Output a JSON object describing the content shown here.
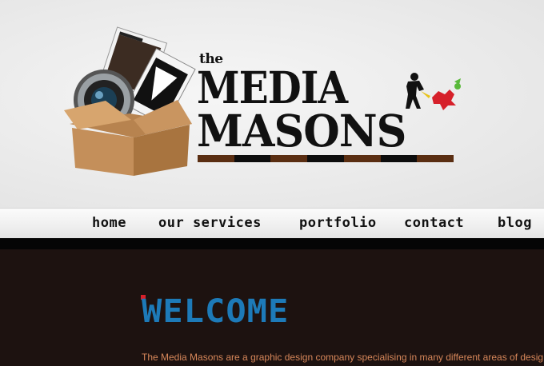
{
  "logo": {
    "the": "the",
    "line1": "MEDIA",
    "line2": "MASONS",
    "bar_colors": [
      "#5a2e12",
      "#0d0d0d",
      "#5a2e12",
      "#0d0d0d",
      "#5a2e12",
      "#0d0d0d",
      "#5a2e12"
    ]
  },
  "nav": {
    "items": [
      "home",
      "our services",
      "portfolio",
      "contact",
      "blog"
    ]
  },
  "welcome": {
    "title": "WELCOME",
    "intro": "The Media Masons are a graphic design company specialising in many different areas of desig"
  },
  "colors": {
    "accent_blue": "#1d7ab8",
    "accent_red": "#d6202a",
    "text_orange": "#d7875a",
    "content_bg": "#1d1210"
  }
}
